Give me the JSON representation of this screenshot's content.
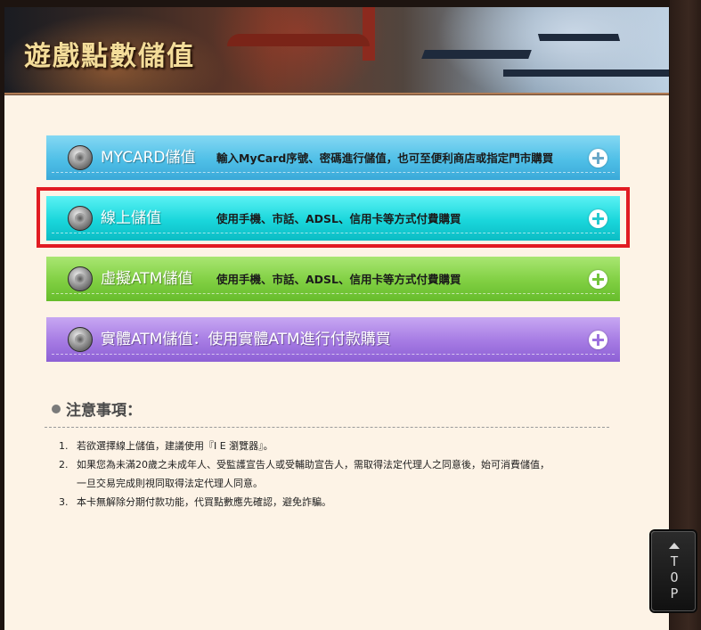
{
  "header": {
    "title": "遊戲點數儲值"
  },
  "options": [
    {
      "label": "MYCARD儲值",
      "desc": "輸入MyCard序號、密碼進行儲值，也可至便利商店或指定門市購買",
      "color": "#4fbfe7"
    },
    {
      "label": "線上儲值",
      "desc": "使用手機、市話、ADSL、信用卡等方式付費購買",
      "color": "#1ad6db",
      "highlighted": true
    },
    {
      "label": "虛擬ATM儲值",
      "desc": "使用手機、市話、ADSL、信用卡等方式付費購買",
      "color": "#80cf42"
    },
    {
      "label": "實體ATM儲值：使用實體ATM進行付款購買",
      "desc": "",
      "color": "#a57ae3"
    }
  ],
  "notice": {
    "title": "注意事項：",
    "items": [
      {
        "num": "1.",
        "text": "若欲選擇線上儲值，建議使用『I E 瀏覽器』。"
      },
      {
        "num": "2.",
        "text": "如果您為未滿20歲之未成年人、受監護宣告人或受輔助宣告人，需取得法定代理人之同意後，始可消費儲值，",
        "cont": "一旦交易完成則視同取得法定代理人同意。"
      },
      {
        "num": "3.",
        "text": "本卡無解除分期付款功能，代買點數應先確認，避免詐騙。"
      }
    ]
  },
  "top_button": {
    "label": "T\nO\nP"
  },
  "colors": {
    "highlight_border": "#e11b22",
    "page_bg": "#fdf3e6"
  }
}
